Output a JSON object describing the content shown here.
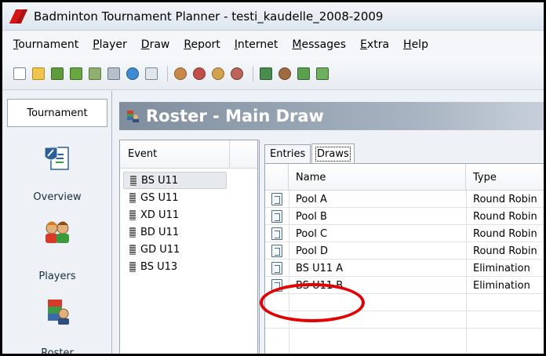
{
  "window": {
    "title": "Badminton Tournament Planner - testi_kaudelle_2008-2009"
  },
  "menu": [
    {
      "underline": "T",
      "rest": "ournament"
    },
    {
      "underline": "P",
      "rest": "layer"
    },
    {
      "underline": "D",
      "rest": "raw"
    },
    {
      "underline": "R",
      "rest": "eport"
    },
    {
      "underline": "I",
      "rest": "nternet"
    },
    {
      "underline": "M",
      "rest": "essages"
    },
    {
      "underline": "E",
      "rest": "xtra"
    },
    {
      "underline": "H",
      "rest": "elp"
    }
  ],
  "toolbar": {
    "icons": [
      "new-icon",
      "open-icon",
      "save-icon",
      "save-as-icon",
      "settings-icon",
      "print-icon",
      "globe-icon",
      "message-icon",
      "player-icon",
      "player-edit-icon",
      "players-icon",
      "player-delete-icon",
      "roster-icon",
      "seed-icon",
      "draw-icon",
      "draw-edit-icon"
    ]
  },
  "leftnav": {
    "tab_label": "Tournament",
    "items": [
      {
        "label": "Overview"
      },
      {
        "label": "Players"
      },
      {
        "label": "Roster"
      }
    ]
  },
  "main": {
    "title": "Roster - Main Draw",
    "event_header": "Event",
    "events": [
      "BS U11",
      "GS U11",
      "XD U11",
      "BD U11",
      "GD U11",
      "BS U13"
    ],
    "selected_event": "BS U11",
    "tabs": [
      {
        "label": "Entries"
      },
      {
        "label": "Draws"
      }
    ],
    "active_tab": "Draws",
    "columns": [
      "Name",
      "Type"
    ],
    "rows": [
      {
        "name": "Pool A",
        "type": "Round Robin"
      },
      {
        "name": "Pool B",
        "type": "Round Robin"
      },
      {
        "name": "Pool C",
        "type": "Round Robin"
      },
      {
        "name": "Pool D",
        "type": "Round Robin"
      },
      {
        "name": "BS U11 A",
        "type": "Elimination"
      },
      {
        "name": "BS U11 B",
        "type": "Elimination"
      }
    ]
  },
  "colors": {
    "highlight": "#e30000",
    "header_gradient_start": "#7f8d9d"
  }
}
